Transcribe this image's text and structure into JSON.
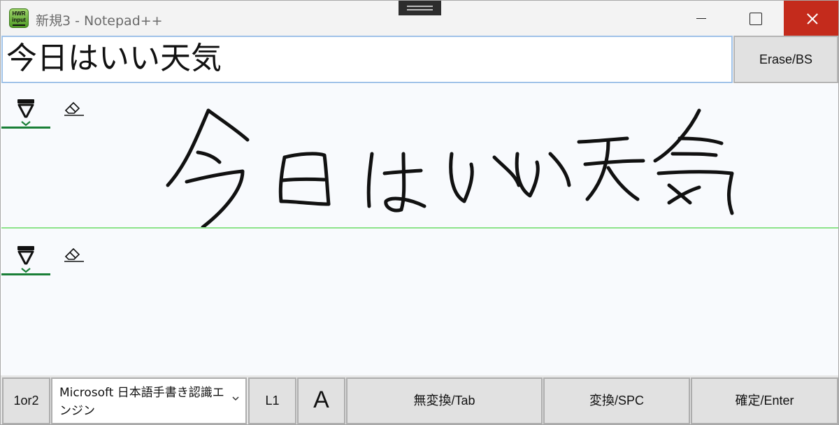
{
  "window": {
    "title": "新規3 - Notepad++",
    "app_icon": {
      "name": "hwr-input-icon",
      "text_line1": "HWR",
      "text_line2": "input"
    },
    "controls": {
      "minimize": "minimize-icon",
      "maximize": "maximize-icon",
      "close": "close-icon",
      "close_color": "#c42b1c"
    }
  },
  "result": {
    "text": "今日はいい天気",
    "erase_label": "Erase/BS"
  },
  "panels": [
    {
      "pen_icon": "pen-icon",
      "eraser_icon": "eraser-icon",
      "has_strokes": true
    },
    {
      "pen_icon": "pen-icon",
      "eraser_icon": "eraser-icon",
      "has_strokes": false
    }
  ],
  "bottom_bar": {
    "mode_button": "1or2",
    "engine_select": "Microsoft 日本語手書き認識エンジン",
    "l1_button": "L1",
    "a_button": "A",
    "muhenkan_button": "無変換/Tab",
    "henkan_button": "変換/SPC",
    "confirm_button": "確定/Enter"
  },
  "colors": {
    "active_tool_underline": "#1a7f37",
    "panel_separator": "#8de38a",
    "input_border": "#9fc2e8"
  }
}
